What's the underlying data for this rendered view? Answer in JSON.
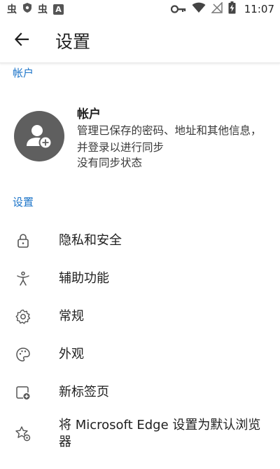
{
  "status_bar": {
    "left_icons": [
      "notification-glyph",
      "vpn-shield-icon",
      "notification-glyph",
      "app-letter-icon"
    ],
    "left_glyph_1": "虫",
    "left_glyph_2": "虫",
    "app_letter": "A",
    "right_icons": [
      "key-icon",
      "wifi-icon",
      "no-signal-icon",
      "battery-charging-icon"
    ],
    "time": "11:07"
  },
  "app_bar": {
    "back_icon": "arrow-left-icon",
    "title": "设置"
  },
  "account_section": {
    "header": "帐户",
    "avatar_icon": "person-add-icon",
    "name": "帐户",
    "description": "管理已保存的密码、地址和其他信息，并登录以进行同步",
    "sync_status": "没有同步状态"
  },
  "settings_section": {
    "header": "设置",
    "items": [
      {
        "label": "隐私和安全",
        "icon": "lock-icon"
      },
      {
        "label": "辅助功能",
        "icon": "accessibility-icon"
      },
      {
        "label": "常规",
        "icon": "gear-icon"
      },
      {
        "label": "外观",
        "icon": "palette-icon"
      },
      {
        "label": "新标签页",
        "icon": "new-tab-icon"
      },
      {
        "label": "将 Microsoft Edge 设置为默认浏览器",
        "icon": "star-gear-icon"
      }
    ]
  },
  "colors": {
    "accent": "#1a73c8",
    "avatar_bg": "#5f5f5f",
    "text_primary": "#1f1f1f"
  }
}
